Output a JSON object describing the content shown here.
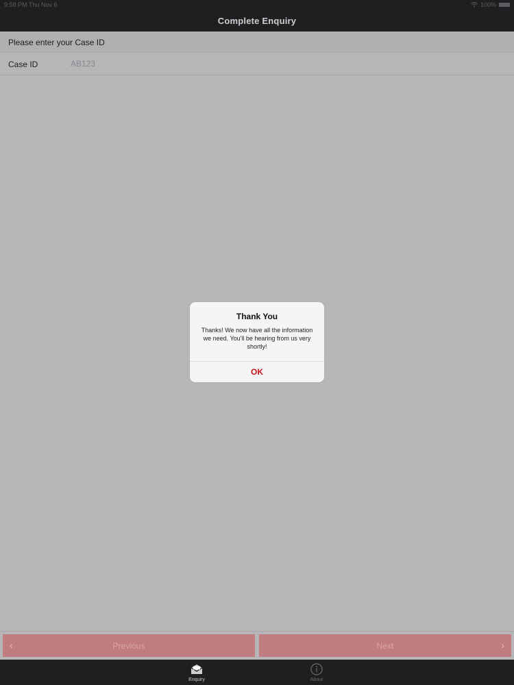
{
  "status_bar": {
    "time": "9:58 PM",
    "date": "Thu Nov 6",
    "wifi_icon": "wifi-icon",
    "battery": "100%",
    "battery_icon": "battery-icon"
  },
  "nav": {
    "title": "Complete Enquiry"
  },
  "form": {
    "section_header": "Please enter your Case ID",
    "case_id_label": "Case ID",
    "case_id_placeholder": "AB123",
    "case_id_value": ""
  },
  "alert": {
    "title": "Thank You",
    "message": "Thanks! We now have all the information we need. You'll be hearing from us very shortly!",
    "ok_label": "OK"
  },
  "pager": {
    "previous_label": "Previous",
    "next_label": "Next",
    "previous_icon": "chevron-left-icon",
    "next_icon": "chevron-right-icon"
  },
  "tabs": [
    {
      "label": "Enquiry",
      "icon": "envelope-icon",
      "selected": true
    },
    {
      "label": "About",
      "icon": "info-icon",
      "selected": false
    }
  ],
  "colors": {
    "nav_background": "#1f1e20",
    "content_background": "#b7b5b8",
    "accent_red": "#c8151b",
    "pager_button": "#c07d7f"
  }
}
